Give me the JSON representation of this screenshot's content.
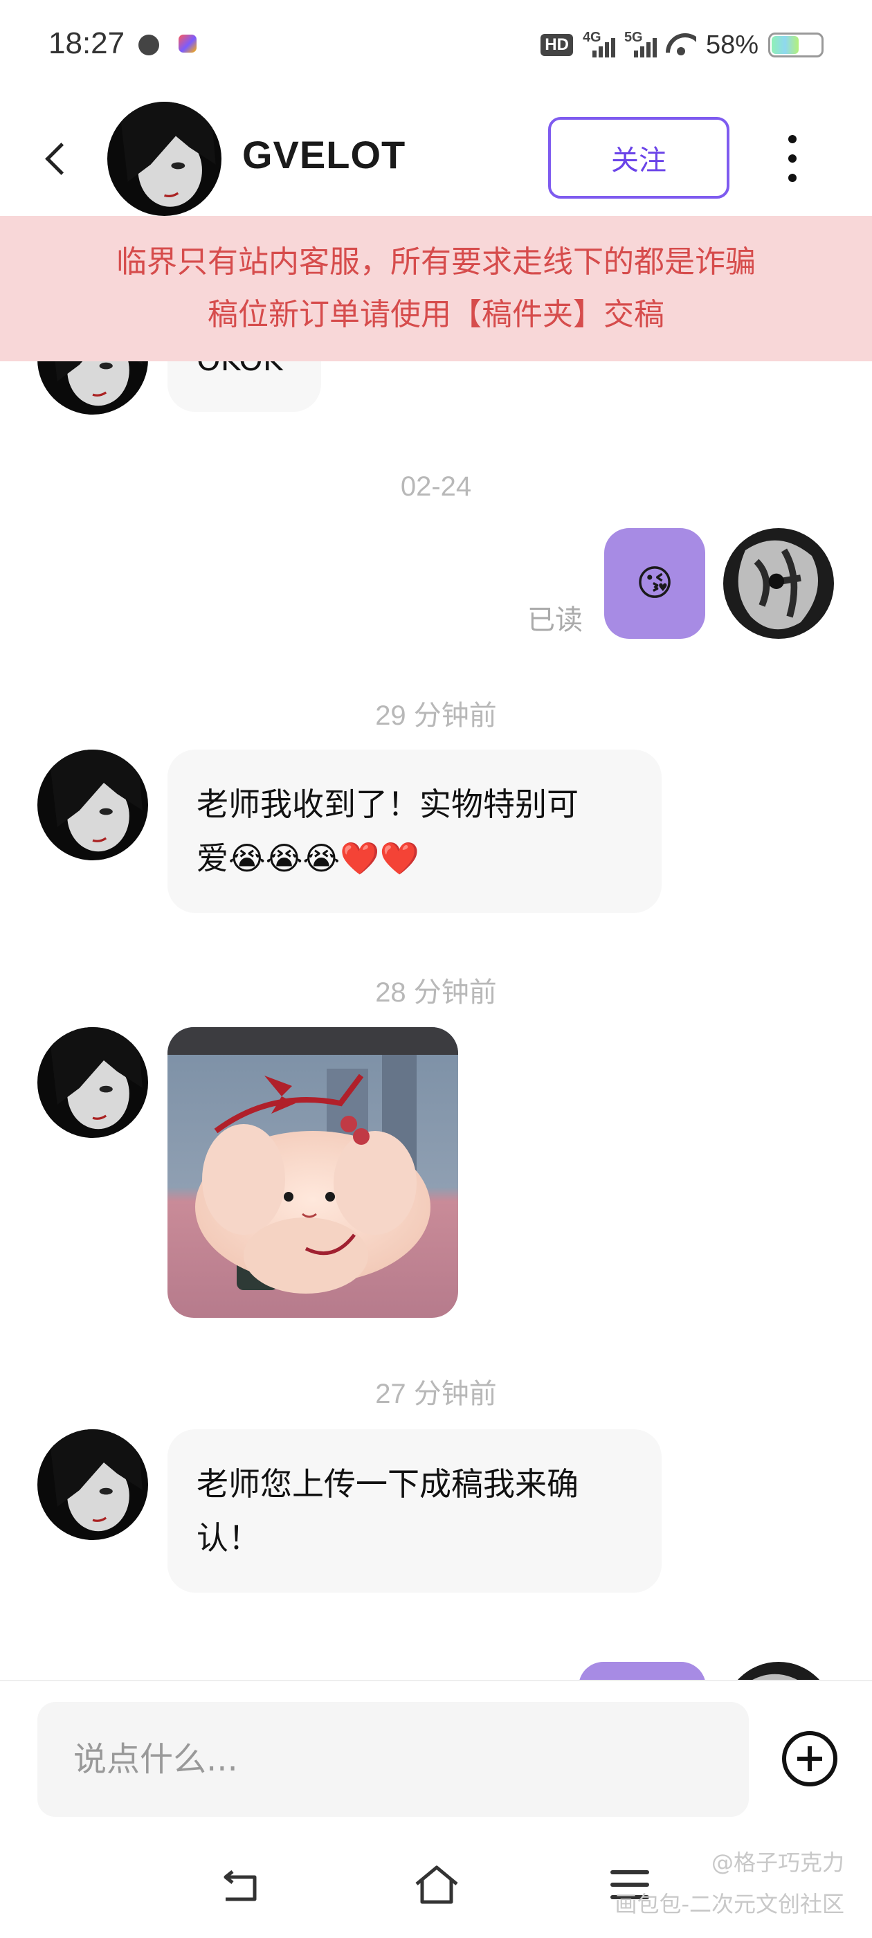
{
  "status_bar": {
    "time": "18:27",
    "hd_label": "HD",
    "net1_label": "4G",
    "net2_label": "5G",
    "battery": "58%",
    "battery_level": 0.58,
    "icons": [
      "globe-icon",
      "app-notification-icon",
      "hd-volte-icon",
      "signal-4g-icon",
      "signal-5g-icon",
      "wifi-icon",
      "battery-icon"
    ]
  },
  "header": {
    "contact_name": "GVELOT",
    "follow_label": "关注",
    "icons": [
      "back-arrow-icon",
      "more-vertical-icon"
    ]
  },
  "notice": {
    "line1": "临界只有站内客服，所有要求走线下的都是诈骗",
    "line2": "稿位新订单请使用【稿件夹】交稿"
  },
  "messages": {
    "partial_top_text": "OKOK",
    "ts1": "02-24",
    "sent_emoji": "😘",
    "read_status": "已读",
    "ts2": "29 分钟前",
    "msg1_line1": "老师我收到了！实物特别可",
    "msg1_line2": "爱😭😭😭❤️❤️",
    "ts3": "28 分钟前",
    "photo_description": "plush-toy-photo",
    "ts4": "27 分钟前",
    "msg2_line1": "老师您上传一下成稿我来确",
    "msg2_line2": "认！"
  },
  "input_bar": {
    "placeholder": "说点什么...",
    "value": ""
  },
  "nav_bar": {
    "icons": [
      "nav-back-icon",
      "nav-home-icon",
      "nav-menu-icon"
    ]
  },
  "watermark": {
    "line1": "@格子巧克力",
    "line2": "画包包-二次元文创社区"
  },
  "colors": {
    "accent_purple": "#7e5bef",
    "sent_bubble": "#a78be4",
    "notice_bg": "#f8d7d8",
    "notice_text": "#d64c4c",
    "received_bubble": "#f7f7f7"
  }
}
